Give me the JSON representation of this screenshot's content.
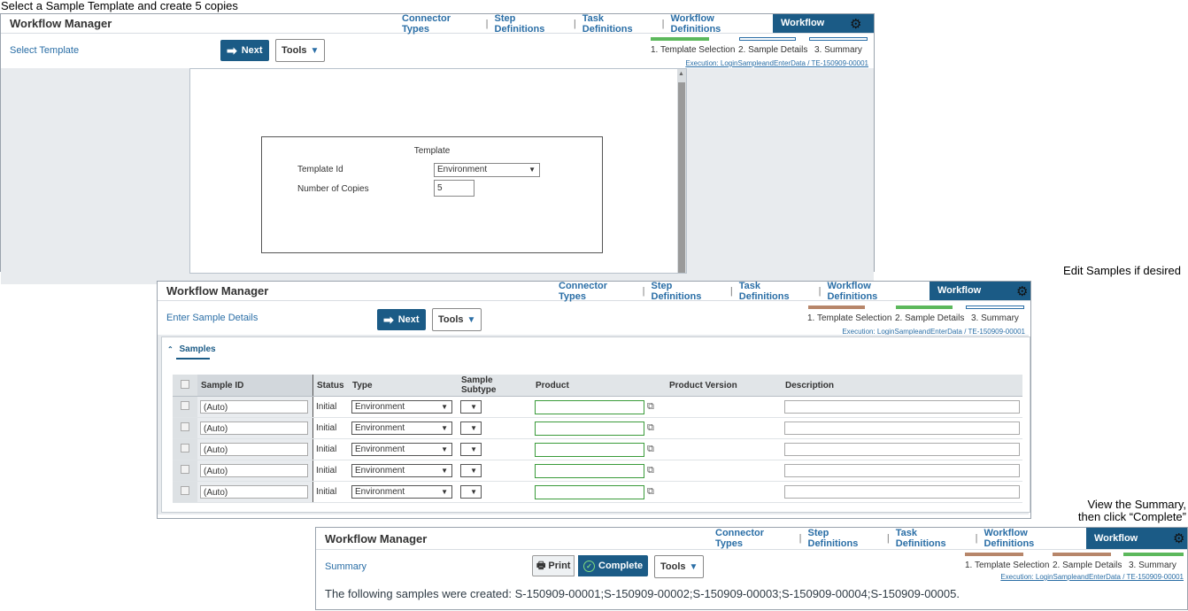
{
  "captions": {
    "top": "Select a Sample Template and create 5 copies",
    "edit": "Edit Samples if desired",
    "summary1": "View the Summary,",
    "summary2": "then click “Complete”"
  },
  "nav": {
    "title": "Workflow Manager",
    "connector_types": "Connector Types",
    "step_definitions": "Step Definitions",
    "task_definitions": "Task Definitions",
    "workflow_definitions": "Workflow Definitions",
    "workflow_manager": "Workflow Manager",
    "sep": "|"
  },
  "steps": {
    "s1": "1. Template Selection",
    "s2": "2. Sample Details",
    "s3": "3. Summary",
    "execution": "Execution: LoginSampleandEnterData / TE-150909-00001"
  },
  "colors": {
    "done": "#b7866a",
    "current": "#5cb85c",
    "pending": "#2a6ea6",
    "accent": "#1b5b86"
  },
  "panel1": {
    "sub_label": "Select Template",
    "next": "Next",
    "tools": "Tools",
    "template_title": "Template",
    "template_id_label": "Template Id",
    "template_id_value": "Environment",
    "copies_label": "Number of Copies",
    "copies_value": "5"
  },
  "panel2": {
    "sub_label": "Enter Sample Details",
    "next": "Next",
    "tools": "Tools",
    "section": "Samples",
    "columns": {
      "sample_id": "Sample ID",
      "status": "Status",
      "type": "Type",
      "subtype": "Sample Subtype",
      "product": "Product",
      "product_version": "Product Version",
      "description": "Description"
    },
    "rows": [
      {
        "sample_id": "(Auto)",
        "status": "Initial",
        "type": "Environment"
      },
      {
        "sample_id": "(Auto)",
        "status": "Initial",
        "type": "Environment"
      },
      {
        "sample_id": "(Auto)",
        "status": "Initial",
        "type": "Environment"
      },
      {
        "sample_id": "(Auto)",
        "status": "Initial",
        "type": "Environment"
      },
      {
        "sample_id": "(Auto)",
        "status": "Initial",
        "type": "Environment"
      }
    ]
  },
  "panel3": {
    "sub_label": "Summary",
    "print": "Print",
    "complete": "Complete",
    "tools": "Tools",
    "created": "The following samples were created: S-150909-00001;S-150909-00002;S-150909-00003;S-150909-00004;S-150909-00005."
  }
}
